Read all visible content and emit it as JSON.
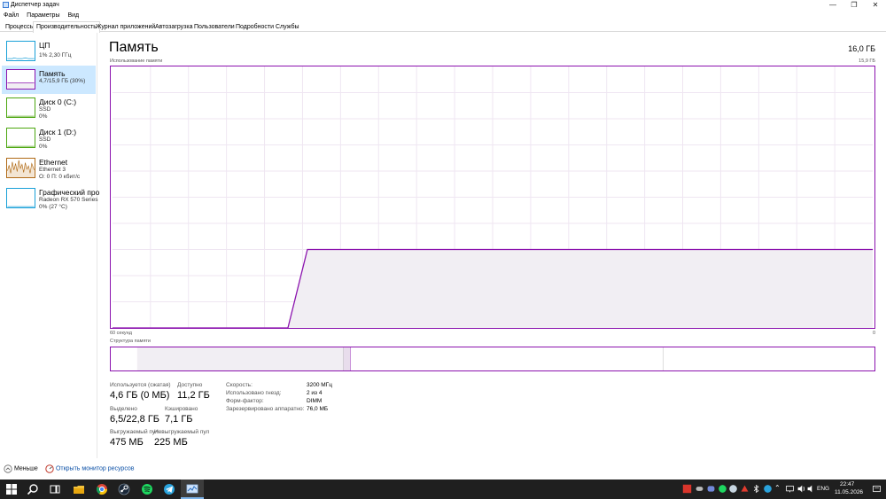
{
  "window": {
    "title": "Диспетчер задач",
    "menu": [
      "Файл",
      "Параметры",
      "Вид"
    ]
  },
  "tabs": [
    "Процессы",
    "Производительность",
    "Журнал приложений",
    "Автозагрузка",
    "Пользователи",
    "Подробности",
    "Службы"
  ],
  "active_tab": "Производительность",
  "sidebar": {
    "items": [
      {
        "name": "ЦП",
        "sub1": "1% 2,30 ГГц",
        "sub2": ""
      },
      {
        "name": "Память",
        "sub1": "4,7/15,9 ГБ (30%)",
        "sub2": ""
      },
      {
        "name": "Диск 0 (C:)",
        "sub1": "SSD",
        "sub2": "0%"
      },
      {
        "name": "Диск 1 (D:)",
        "sub1": "SSD",
        "sub2": "0%"
      },
      {
        "name": "Ethernet",
        "sub1": "Ethernet 3",
        "sub2": "О: 0 П: 0 кбит/с"
      },
      {
        "name": "Графический про",
        "sub1": "Radeon RX 570 Series",
        "sub2": "0% (27 °C)"
      }
    ]
  },
  "memory": {
    "title": "Память",
    "total": "16,0 ГБ",
    "usage_label": "Использование памяти",
    "usage_max": "15,9 ГБ",
    "time_left": "60 секунд",
    "time_right": "0",
    "composition_label": "Структура памяти",
    "usage_series_fraction": [
      0,
      0,
      0,
      0,
      0,
      0,
      0,
      0,
      0,
      0,
      0.3,
      0.3,
      0.3,
      0.3,
      0.3,
      0.3,
      0.3,
      0.3,
      0.3,
      0.3,
      0.3,
      0.3,
      0.3,
      0.3,
      0.3,
      0.3,
      0.3,
      0.3,
      0.3,
      0.3,
      0.3,
      0.3,
      0.3,
      0.3,
      0.3,
      0.3,
      0.3,
      0.3,
      0.3,
      0.3
    ],
    "composition_fraction": {
      "in_use": 0.29,
      "modified": 0.01,
      "standby": 0.44,
      "free": 0.26
    },
    "stats": {
      "in_use_label": "Используется (сжатая)",
      "in_use_value": "4,6 ГБ (0 МБ)",
      "available_label": "Доступно",
      "available_value": "11,2 ГБ",
      "committed_label": "Выделено",
      "committed_value": "6,5/22,8 ГБ",
      "cached_label": "Кэшировано",
      "cached_value": "7,1 ГБ",
      "paged_label": "Выгружаемый пул",
      "paged_value": "475 МБ",
      "nonpaged_label": "Невыгружаемый пул",
      "nonpaged_value": "225 МБ"
    },
    "specs": {
      "speed_label": "Скорость:",
      "speed_value": "3200 МГц",
      "slots_label": "Использовано гнезд:",
      "slots_value": "2 из 4",
      "form_label": "Форм-фактор:",
      "form_value": "DIMM",
      "reserved_label": "Зарезервировано аппаратно:",
      "reserved_value": "76,0 МБ"
    }
  },
  "footer": {
    "less_label": "Меньше",
    "monitor_label": "Открыть монитор ресурсов"
  },
  "taskbar": {
    "language": "ENG",
    "time": "22:47",
    "date": "11.05.2026"
  },
  "colors": {
    "memory_line": "#8b12ae",
    "memory_fill": "#f1eef3",
    "cpu_line": "#1aa0d8",
    "disk_line": "#4ca60f",
    "ethernet_line": "#b06a16",
    "selected_bg": "#cce8ff"
  }
}
